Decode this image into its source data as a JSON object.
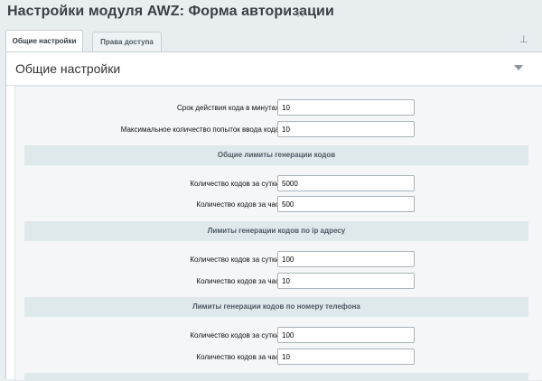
{
  "header": {
    "title": "Настройки модуля AWZ: Форма авторизации"
  },
  "tabs": [
    {
      "label": "Общие настройки"
    },
    {
      "label": "Права доступа"
    }
  ],
  "panel": {
    "title": "Общие настройки"
  },
  "fields": {
    "code_lifetime": {
      "label": "Срок действия кода в минутах",
      "value": "10"
    },
    "max_attempts": {
      "label": "Максимальное количество попыток ввода кода",
      "value": "10"
    }
  },
  "sections": {
    "general": {
      "title": "Общие лимиты генерации кодов",
      "per_day": {
        "label": "Количество кодов за сутки",
        "value": "5000"
      },
      "per_hour": {
        "label": "Количество кодов за час",
        "value": "500"
      }
    },
    "ip": {
      "title": "Лимиты генерации кодов по ip адресу",
      "per_day": {
        "label": "Количество кодов за сутки",
        "value": "100"
      },
      "per_hour": {
        "label": "Количество кодов за час",
        "value": "10"
      }
    },
    "phone": {
      "title": "Лимиты генерации кодов по номеру телефона",
      "per_day": {
        "label": "Количество кодов за сутки",
        "value": "100"
      },
      "per_hour": {
        "label": "Количество кодов за час",
        "value": "10"
      }
    }
  }
}
